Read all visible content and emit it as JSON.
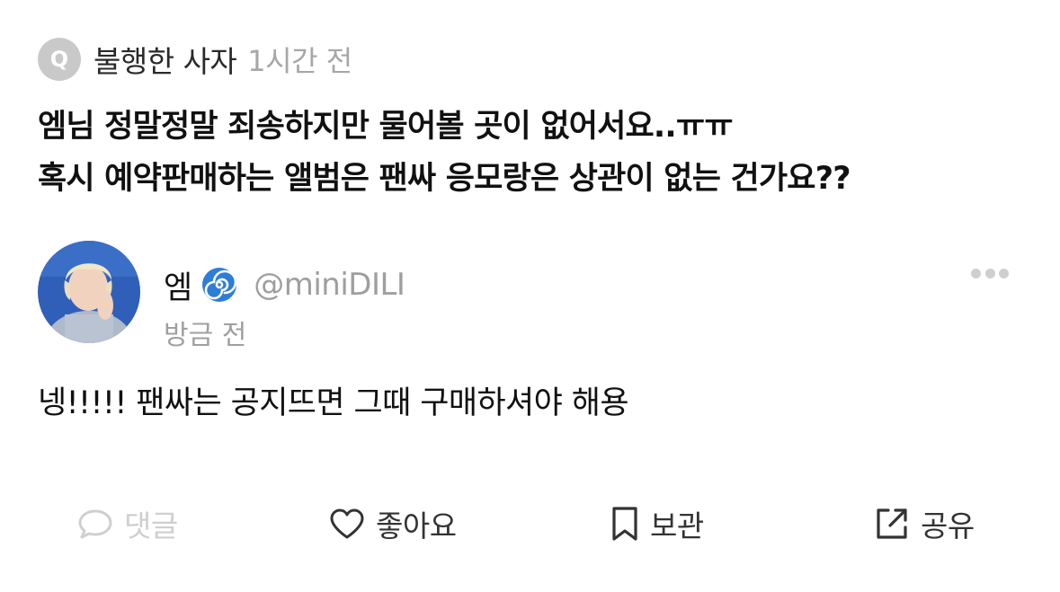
{
  "question": {
    "badge": "Q",
    "asker_name": "불행한 사자",
    "time": "1시간 전",
    "lines": [
      "엠님 정말정말 죄송하지만 물어볼 곳이 없어서요..ㅠㅠ",
      "혹시 예약판매하는 앨범은 팬싸 응모랑은 상관이 없는 건가요??"
    ]
  },
  "answer": {
    "name": "엠",
    "emoji_icon": "cyclone-icon",
    "handle": "@miniDILI",
    "time": "방금 전",
    "text": "넹!!!!! 팬싸는 공지뜨면 그때 구매하셔야 해용"
  },
  "actions": {
    "comment_label": "댓글",
    "like_label": "좋아요",
    "save_label": "보관",
    "share_label": "공유"
  },
  "colors": {
    "badge_bg": "#c9c9c9",
    "muted_text": "#a7a7a7",
    "disabled_action": "#cfcfcf",
    "primary_text": "#111111",
    "action_text": "#333333"
  }
}
